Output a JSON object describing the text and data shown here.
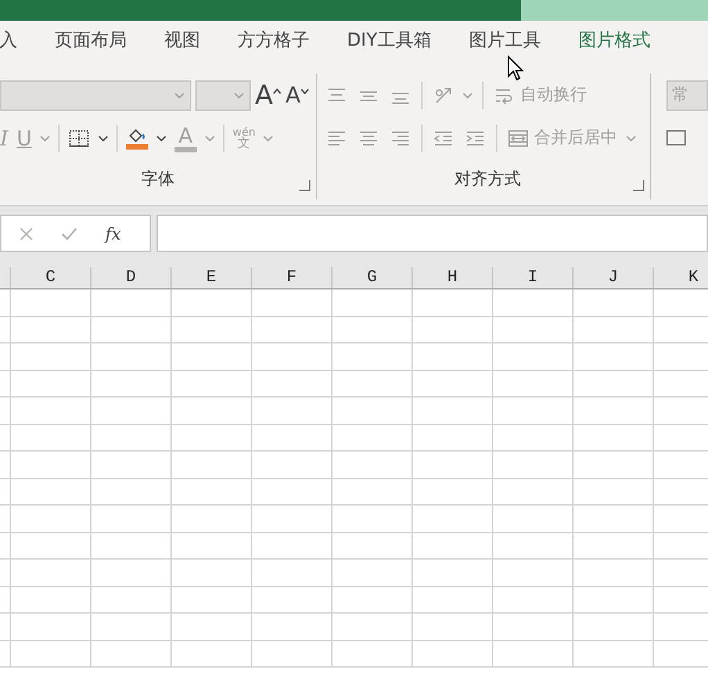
{
  "tabs": [
    {
      "label": "入",
      "selected": false
    },
    {
      "label": "页面布局",
      "selected": false
    },
    {
      "label": "视图",
      "selected": false
    },
    {
      "label": "方方格子",
      "selected": false
    },
    {
      "label": "DIY工具箱",
      "selected": false
    },
    {
      "label": "图片工具",
      "selected": false
    },
    {
      "label": "图片格式",
      "selected": true
    }
  ],
  "font_group": {
    "label": "字体",
    "row_1": [
      {
        "kind": "font-name",
        "disabled": true
      },
      {
        "kind": "font-size",
        "disabled": true
      },
      {
        "kind": "grow-font",
        "glyph": "A",
        "disabled": false
      },
      {
        "kind": "shrink-font",
        "glyph": "A",
        "disabled": false
      }
    ],
    "row_2": [
      {
        "kind": "italic",
        "glyph": "I",
        "disabled": true
      },
      {
        "kind": "underline",
        "glyph": "U",
        "disabled": true,
        "dropdown": true
      },
      {
        "kind": "sep"
      },
      {
        "kind": "borders",
        "disabled": false,
        "dropdown": true
      },
      {
        "kind": "sep"
      },
      {
        "kind": "fill-color",
        "disabled": false,
        "dropdown": true,
        "color": "#ed7d31"
      },
      {
        "kind": "font-color",
        "glyph": "A",
        "disabled": true,
        "dropdown": true,
        "color": "#b3b0ad"
      },
      {
        "kind": "sep"
      },
      {
        "kind": "phonetic",
        "glyph": "wén",
        "glyph_2": "文",
        "disabled": true,
        "dropdown": true
      }
    ]
  },
  "alignment_group": {
    "label": "对齐方式",
    "row_1": [
      {
        "kind": "align-top",
        "disabled": true
      },
      {
        "kind": "align-middle",
        "disabled": true
      },
      {
        "kind": "align-bottom",
        "disabled": true
      },
      {
        "kind": "sep"
      },
      {
        "kind": "orientation",
        "disabled": true,
        "dropdown": true
      },
      {
        "kind": "sep"
      },
      {
        "kind": "wrap-text",
        "label": "自动换行",
        "disabled": true
      }
    ],
    "row_2": [
      {
        "kind": "align-left",
        "disabled": true
      },
      {
        "kind": "align-center",
        "disabled": true
      },
      {
        "kind": "align-right",
        "disabled": true
      },
      {
        "kind": "sep"
      },
      {
        "kind": "indent-decrease",
        "disabled": true
      },
      {
        "kind": "indent-increase",
        "disabled": true
      },
      {
        "kind": "sep"
      },
      {
        "kind": "merge-center",
        "label": "合并后居中",
        "disabled": true,
        "dropdown": true
      }
    ]
  },
  "number_group": {
    "format_box": {
      "value": "常",
      "disabled": true
    }
  },
  "formula_bar": {
    "buttons": [
      {
        "kind": "cancel",
        "disabled": true
      },
      {
        "kind": "enter",
        "disabled": true
      },
      {
        "kind": "function",
        "label": "fx",
        "disabled": false
      }
    ]
  },
  "sheet": {
    "columns": [
      "C",
      "D",
      "E",
      "F",
      "G",
      "H",
      "I",
      "J",
      "K"
    ]
  }
}
